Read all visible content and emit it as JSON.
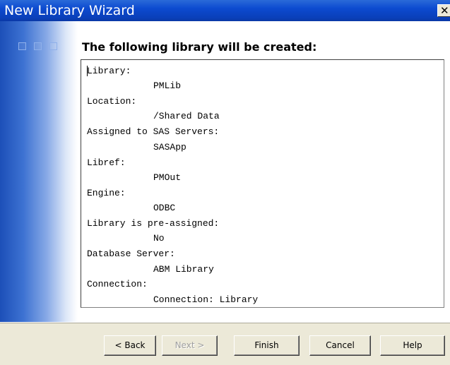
{
  "window": {
    "title": "New Library Wizard",
    "close_glyph": "✕",
    "title_bar_color": "#0c4ad0"
  },
  "main": {
    "heading": "The following library will be created:",
    "summary": [
      {
        "label": "Library:",
        "value": "PMLib"
      },
      {
        "label": "Location:",
        "value": "/Shared Data"
      },
      {
        "label": "Assigned to SAS Servers:",
        "value": "SASApp"
      },
      {
        "label": "Libref:",
        "value": "PMOut"
      },
      {
        "label": "Engine:",
        "value": "ODBC"
      },
      {
        "label": "Library is pre-assigned:",
        "value": "No"
      },
      {
        "label": "Database Server:",
        "value": "ABM Library"
      },
      {
        "label": "Connection:",
        "value": "Connection: Library"
      }
    ]
  },
  "buttons": {
    "back": "< Back",
    "next": "Next >",
    "finish": "Finish",
    "cancel": "Cancel",
    "help": "Help"
  }
}
